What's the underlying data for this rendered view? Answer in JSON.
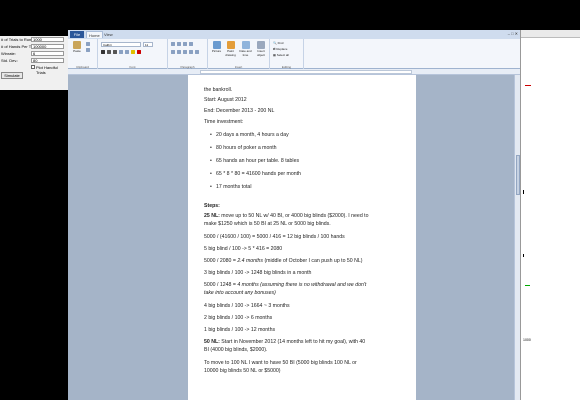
{
  "sim_panel": {
    "fields": [
      {
        "label": "# of Trials to Run:",
        "value": "1000"
      },
      {
        "label": "# of Hands Per Trial:",
        "value": "100000"
      },
      {
        "label": "Winrate:",
        "value": "6"
      },
      {
        "label": "Std. Dev.:",
        "value": "80"
      }
    ],
    "checkbox_label": "Plot Handful Trials",
    "simulate_label": "Simulate"
  },
  "word": {
    "file_tab": "File",
    "tabs": [
      "Home",
      "View"
    ],
    "window_controls": "–  □  ✕",
    "font_name": "Calibri",
    "font_size": "11",
    "group_labels": [
      "Clipboard",
      "Font",
      "Paragraph",
      "Insert",
      "Editing"
    ],
    "paste_label": "Paste",
    "insert_buttons": [
      "Picture",
      "Paint drawing",
      "Date and time",
      "Insert object"
    ],
    "editing_items": [
      "Find",
      "Replace",
      "Select all"
    ]
  },
  "document": {
    "lines": {
      "l0": "the bankroll.",
      "l1": "Start: August 2012",
      "l2": "End: December 2013 - 200 NL",
      "l3": "Time investment:",
      "b1": "20 days a month, 4 hours a day",
      "b2": "80 hours of poker a month",
      "b3": "65 hands an hour per table. 8 tables",
      "b4": "65 * 8 * 80 = 41600 hands  per month",
      "b5": "17 months total",
      "steps": "Steps:",
      "s25a_bold": "25 NL:",
      "s25a": " move up to 50 NL w/ 40 BI, or 4000 big blinds ($2000). I need to",
      "s25b": "make $1250 which is 50 BI at 25 NL or 5000 big blinds.",
      "c1": "5000 / (41600 / 100) = 5000 / 416 = 12 big blinds / 100 hands",
      "c2": "5 big blind / 100 -> 5 * 416 = 2080",
      "c3a": "5000 / 2080 = ",
      "c3b": "2.4 months",
      "c3c": " (middle of October I can push up to 50 NL)",
      "c4": "3 big blinds / 100 -> 1248 big blinds in a month",
      "c5a": "5000 / 1248 = ",
      "c5b": "4 months (assuming there is no withdrawal and we don't",
      "c5c": "take into account any bonuses)",
      "c6": "4 big blinds / 100 -> 1664 ~ 3 months",
      "c7": "2 big blinds / 100 -> 6 months",
      "c8": "1 big blinds / 100 -> 12 months",
      "s50a_bold": "50 NL:",
      "s50a": " Start in November 2012 (14 months left to hit my goal), with 40",
      "s50b": "BI (4000 big blinds, $2000).",
      "t1": "To move to 100 NL I want to have 50 BI (5000 big blinds 100 NL or",
      "t2": "10000 big blinds 50 NL or $5000)"
    }
  },
  "right_panel": {
    "label": "1000"
  }
}
